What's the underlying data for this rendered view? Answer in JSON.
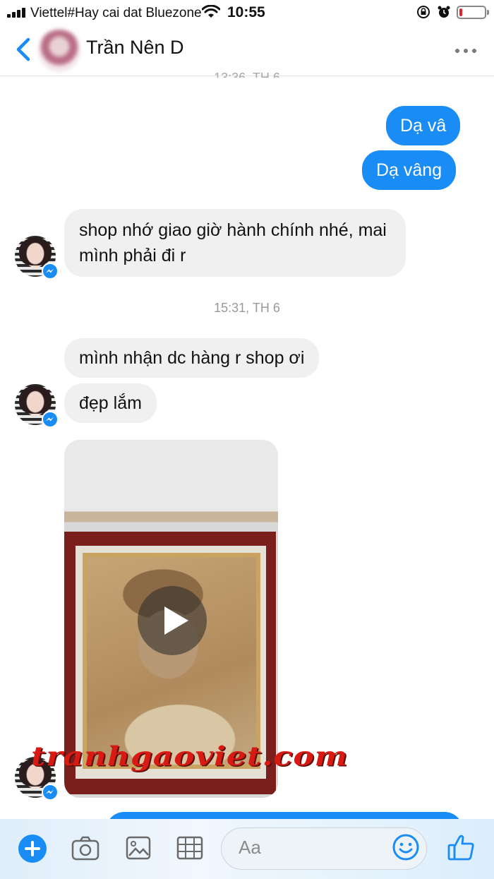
{
  "status_bar": {
    "carrier": "Viettel#Hay cai dat Bluezone",
    "time": "10:55",
    "battery_level": 0.12
  },
  "header": {
    "contact_name": "Trần Nên D",
    "back_icon": "chevron-left-icon",
    "more_icon": "more-dots-icon"
  },
  "conversation": {
    "timestamp_top": "13:36, TH 6",
    "timestamp_mid": "15:31, TH 6",
    "messages": [
      {
        "side": "out",
        "text": "Dạ vâ"
      },
      {
        "side": "out",
        "text": "Dạ vâng"
      },
      {
        "side": "in",
        "text": "shop nhớ giao giờ hành chính nhé, mai mình phải đi r"
      },
      {
        "side": "in",
        "text": "mình nhận dc hàng r shop ơi"
      },
      {
        "side": "in",
        "text": "đẹp lắm"
      },
      {
        "side": "in",
        "type": "video"
      }
    ]
  },
  "watermark": "tranhgaoviet.com",
  "composer": {
    "placeholder": "Aa",
    "icons": [
      "plus-icon",
      "camera-icon",
      "image-icon",
      "grid-icon",
      "emoji-icon",
      "thumbs-up-icon"
    ]
  },
  "colors": {
    "accent": "#1a8cf5",
    "incoming_bubble": "#f0f0f0",
    "watermark": "#d81a12"
  }
}
